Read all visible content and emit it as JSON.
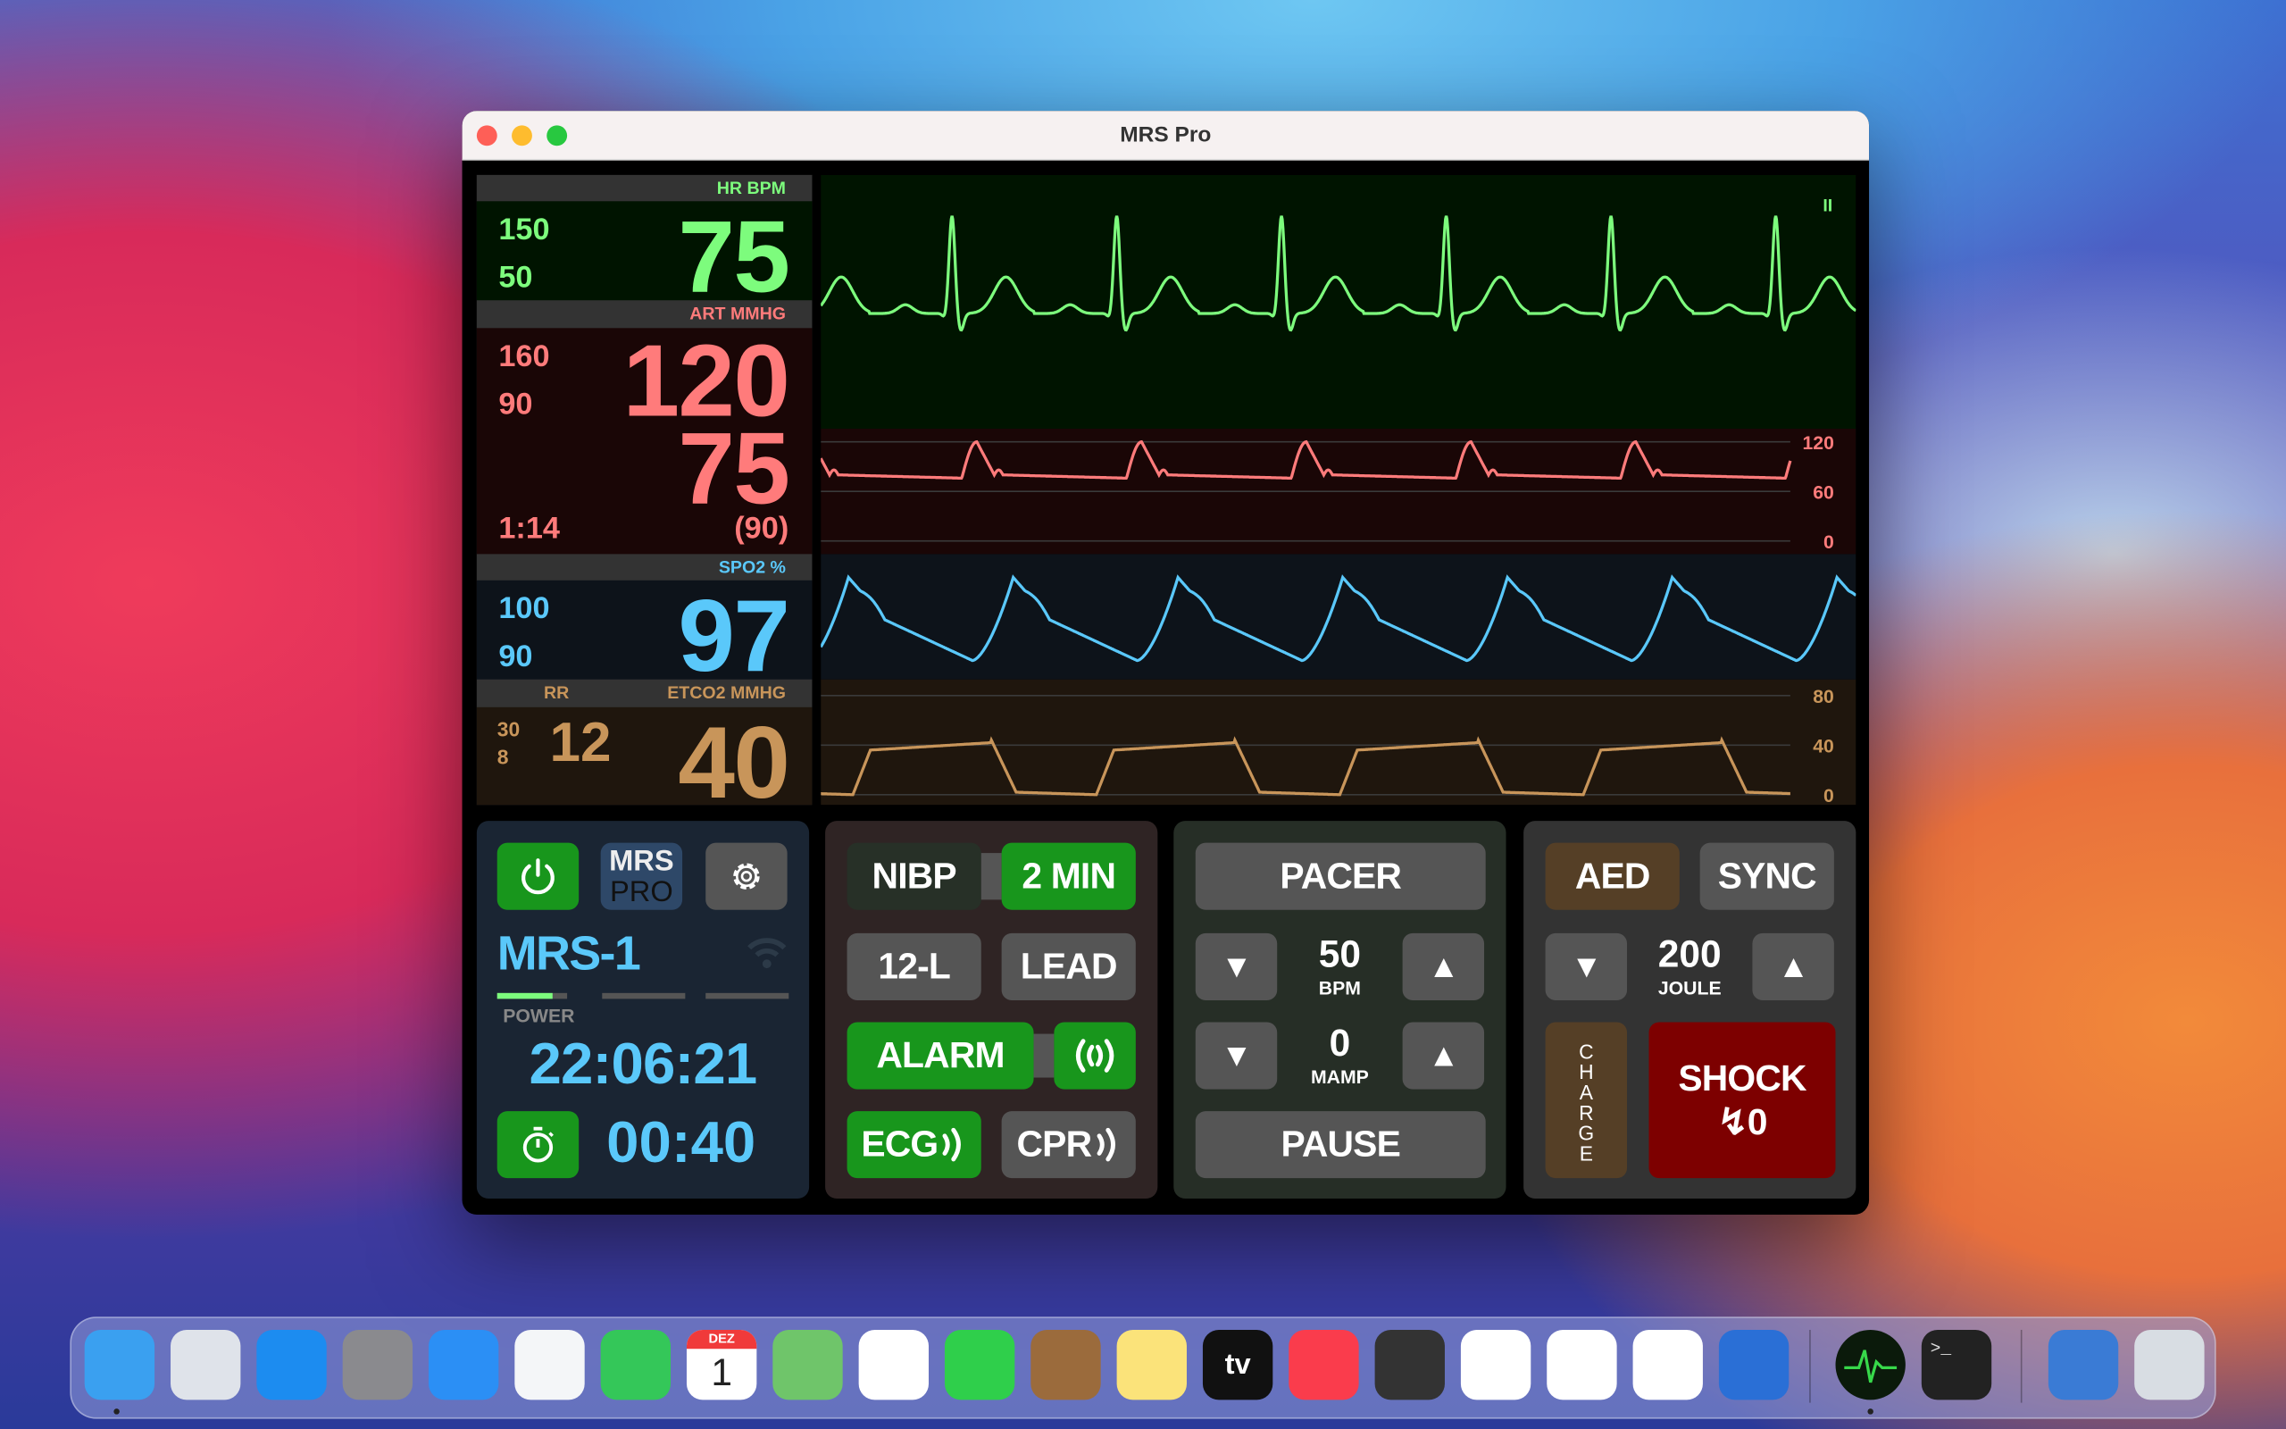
{
  "window": {
    "title": "MRS Pro"
  },
  "colors": {
    "hr": "#7dfc7d",
    "art": "#ff7b7b",
    "spo2": "#5ac8fa",
    "etco2": "#c8955a",
    "button_green": "#18961c",
    "button_gray": "#555555",
    "shock_red": "#7d0000"
  },
  "vitals": {
    "hr": {
      "header": "HR  BPM",
      "high": "150",
      "low": "50",
      "value": "75"
    },
    "art": {
      "header": "ART  MMHG",
      "high": "160",
      "low": "90",
      "systolic": "120",
      "diastolic": "75",
      "mean": "(90)",
      "time": "1:14"
    },
    "spo2": {
      "header": "SPO2  %",
      "high": "100",
      "low": "90",
      "value": "97"
    },
    "etco2": {
      "rr_header": "RR",
      "header": "ETCO2  MMHG",
      "rr_high": "30",
      "rr_low": "8",
      "rr": "12",
      "value": "40"
    }
  },
  "waveforms": {
    "ecg_lead": "II",
    "art_scale": [
      "120",
      "60",
      "0"
    ],
    "etco2_scale": [
      "80",
      "40",
      "0"
    ]
  },
  "device": {
    "power_icon": "power-icon",
    "logo_top": "MRS",
    "logo_bottom": "PRO",
    "settings_icon": "gear-icon",
    "name": "MRS-1",
    "power_label": "POWER",
    "power_level": 0.8,
    "clock": "22:06:21",
    "timer": "00:40"
  },
  "controls": {
    "nibp": "NIBP",
    "nibp_interval": "2 MIN",
    "twelve_lead": "12-L",
    "lead": "LEAD",
    "alarm": "ALARM",
    "alarm_sound_icon": "sound-waves-icon",
    "ecg": "ECG",
    "cpr": "CPR"
  },
  "pacer": {
    "label": "PACER",
    "rate": "50",
    "rate_unit": "BPM",
    "current": "0",
    "current_unit": "MAMP",
    "pause": "PAUSE"
  },
  "defib": {
    "aed": "AED",
    "sync": "SYNC",
    "energy": "200",
    "energy_unit": "JOULE",
    "charge": "CHARGE",
    "shock": "SHOCK",
    "shock_count": "↯0"
  },
  "dock": {
    "calendar_month": "DEZ",
    "calendar_day": "1",
    "tv_label": "tv",
    "items": [
      "finder",
      "launchpad",
      "app-store",
      "system-preferences",
      "mail",
      "safari",
      "messages",
      "calendar",
      "maps",
      "photos",
      "facetime",
      "contacts",
      "notes",
      "apple-tv",
      "music",
      "final-cut-pro",
      "pages",
      "numbers",
      "keynote",
      "xcode",
      "mrs-pro",
      "terminal",
      "instruments",
      "trash"
    ]
  }
}
